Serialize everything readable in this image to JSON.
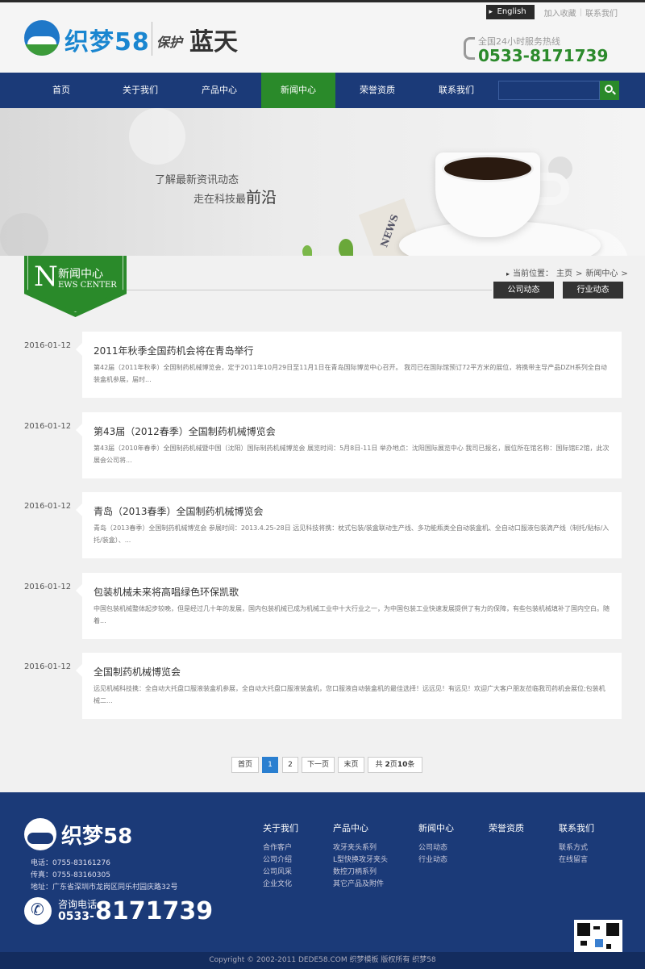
{
  "header": {
    "brand": "织梦58",
    "slogan_small": "保护",
    "slogan_big": "蓝天",
    "english": "English",
    "add_favorite": "加入收藏",
    "divider": "|",
    "contact_us": "联系我们",
    "hotline_label": "全国24小时服务热线",
    "hotline_number": "0533-8171739"
  },
  "nav": {
    "items": [
      "首页",
      "关于我们",
      "产品中心",
      "新闻中心",
      "荣誉资质",
      "联系我们"
    ],
    "active_index": 3,
    "search_placeholder": ""
  },
  "banner": {
    "line1": "了解最新资讯动态",
    "line2_prefix": "走在科技最",
    "line2_big": "前沿",
    "paper_text": "NEWS"
  },
  "section": {
    "badge_letter": "N",
    "badge_cn": "新闻中心",
    "badge_en": "EWS CENTER",
    "crumb_label": "当前位置：",
    "crumb_home": "主页",
    "crumb_current": "新闻中心",
    "crumb_sep": ">",
    "tabs": [
      "公司动态",
      "行业动态"
    ]
  },
  "news": [
    {
      "date": "2016-01-12",
      "title": "2011年秋季全国药机会将在青岛举行",
      "desc": "第42届（2011年秋季）全国制药机械博览会，定于2011年10月29日至11月1日在青岛国际博览中心召开。 我司已在国际馆预订72平方米的展位，将携带主导产品DZH系列全自动装盒机参展，届时..."
    },
    {
      "date": "2016-01-12",
      "title": "第43届（2012春季）全国制药机械博览会",
      "desc": "第43届（2010年春季）全国制药机械暨中国（沈阳）国际制药机械博览会 展览时间：5月8日-11日 举办地点：沈阳国际展览中心 我司已报名，展位所在馆名称：国际馆E2馆，此次展会公司将..."
    },
    {
      "date": "2016-01-12",
      "title": "青岛（2013春季）全国制药机械博览会",
      "desc": "青岛（2013春季）全国制药机械博览会 参展时间：2013.4.25-28日 远见科技将携：枕式包装/装盒联动生产线、多功能瓶类全自动装盒机、全自动口服液包装滴产线（制托/贴标/入托/装盒）、..."
    },
    {
      "date": "2016-01-12",
      "title": "包装机械未来将高唱绿色环保凯歌",
      "desc": "中国包装机械整体起步较晚，但是经过几十年的发展，国内包装机械已成为机械工业中十大行业之一，为中国包装工业快速发展提供了有力的保障，有些包装机械填补了国内空白。随着..."
    },
    {
      "date": "2016-01-12",
      "title": "全国制药机械博览会",
      "desc": "远见机械科技携：全自动大托盘口服液装盒机参展，全自动大托盘口服液装盒机，您口服液自动装盒机的最佳选择！远远见！有远见！欢迎广大客户朋友莅临我司药机会展位;包装机械二..."
    }
  ],
  "pager": {
    "first": "首页",
    "pages": [
      "1",
      "2"
    ],
    "current": "1",
    "next": "下一页",
    "last": "末页",
    "total_prefix": "共",
    "total_pages": "2",
    "total_mid": "页",
    "total_count": "10",
    "total_suffix": "条"
  },
  "footer": {
    "brand": "织梦58",
    "phone": "电话：0755-83161276",
    "fax": "传真：0755-83160305",
    "address": "地址：广东省深圳市龙岗区同乐村园庆路32号",
    "call_label": "咨询电话",
    "call_prefix": "0533-",
    "call_number": "8171739",
    "columns": [
      {
        "heading": "关于我们",
        "links": [
          "合作客户",
          "公司介绍",
          "公司风采",
          "企业文化"
        ]
      },
      {
        "heading": "产品中心",
        "links": [
          "攻牙夹头系列",
          "L型快换攻牙夹头",
          "数控刀柄系列",
          "其它产品及附件"
        ]
      },
      {
        "heading": "新闻中心",
        "links": [
          "公司动态",
          "行业动态"
        ]
      },
      {
        "heading": "荣誉资质",
        "links": []
      },
      {
        "heading": "联系我们",
        "links": [
          "联系方式",
          "在线留言"
        ]
      }
    ],
    "copyright": "Copyright © 2002-2011 DEDE58.COM 织梦模板 版权所有   织梦58"
  }
}
